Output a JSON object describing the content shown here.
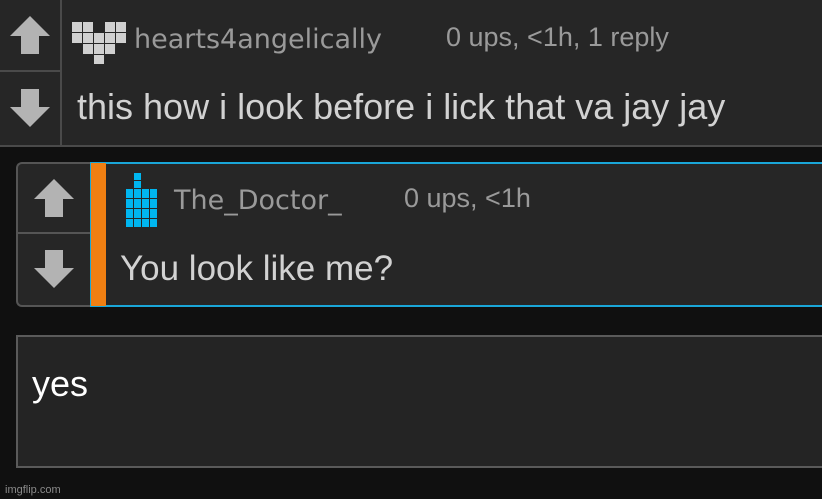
{
  "comment": {
    "username": "hearts4angelically",
    "meta": "0 ups, <1h, 1 reply",
    "text": "this how i look before i lick that va jay jay",
    "avatar_icon": "heart-pixel-icon"
  },
  "reply": {
    "username": "The_Doctor_",
    "meta": "0 ups, <1h",
    "text": "You look like me?",
    "avatar_icon": "bottle-pixel-icon",
    "accent_color": "#f07f12",
    "highlight_color": "#1aa6d8"
  },
  "reply_box": {
    "value": "yes"
  },
  "watermark": "imgflip.com",
  "icons": {
    "upvote": "arrow-up-icon",
    "downvote": "arrow-down-icon"
  }
}
